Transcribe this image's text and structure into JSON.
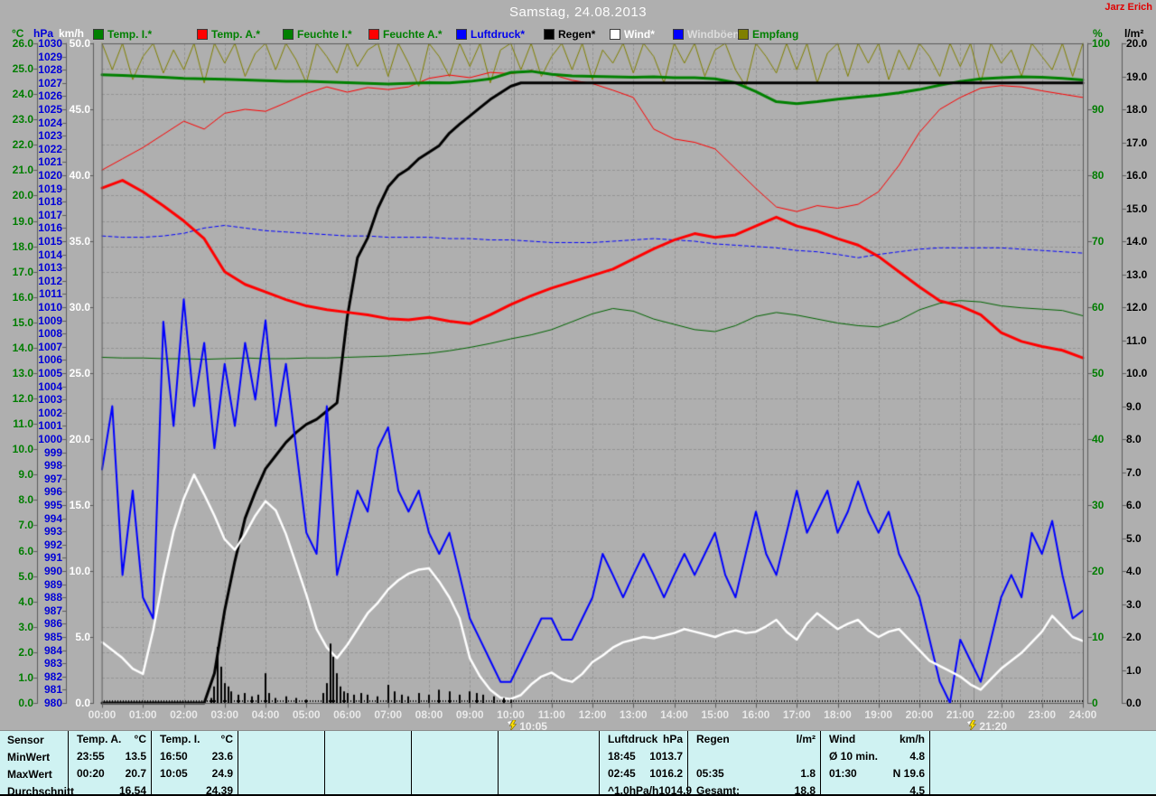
{
  "header": {
    "title": "Samstag, 24.08.2013",
    "author": "Jarz Erich"
  },
  "legend": [
    {
      "label": "Temp. I.*",
      "swatch": "#008000",
      "text_color": "#008000"
    },
    {
      "label": "Temp. A.*",
      "swatch": "#ff0000",
      "text_color": "#008000"
    },
    {
      "label": "Feuchte I.*",
      "swatch": "#008000",
      "text_color": "#008000"
    },
    {
      "label": "Feuchte A.*",
      "swatch": "#ff0000",
      "text_color": "#008000"
    },
    {
      "label": "Luftdruck*",
      "swatch": "#0000ff",
      "text_color": "#0000ee"
    },
    {
      "label": "Regen*",
      "swatch": "#000000",
      "text_color": "#000000"
    },
    {
      "label": "Wind*",
      "swatch": "#ffffff",
      "text_color": "#ffffff"
    },
    {
      "label": "Windböen",
      "swatch": "#0000ff",
      "text_color": "#dcdcdc"
    },
    {
      "label": "Empfang",
      "swatch": "#808000",
      "text_color": "#008000"
    }
  ],
  "chart_data": {
    "type": "line",
    "title": "Samstag, 24.08.2013",
    "x_start": 0,
    "x_end": 24,
    "grid": "dashed, vertical each hour, horizontal each 1°C",
    "x_tick_labels": [
      "00:00",
      "01:00",
      "02:00",
      "03:00",
      "04:00",
      "05:00",
      "06:00",
      "07:00",
      "08:00",
      "09:00",
      "10:00",
      "11:00",
      "12:00",
      "13:00",
      "14:00",
      "15:00",
      "16:00",
      "17:00",
      "18:00",
      "19:00",
      "20:00",
      "21:00",
      "22:00",
      "23:00",
      "24:00"
    ],
    "axes": {
      "temp": {
        "unit": "°C",
        "color": "#007d00",
        "min": 0,
        "max": 26,
        "step": 1,
        "decimals": 1
      },
      "hpa": {
        "unit": "hPa",
        "color": "#0000d8",
        "min": 980,
        "max": 1030,
        "step": 1,
        "decimals": 0
      },
      "kmh": {
        "unit": "km/h",
        "color": "#ffffff",
        "min": 0,
        "max": 50,
        "step": 5,
        "decimals": 1
      },
      "pct": {
        "unit": "%",
        "color": "#007d00",
        "min": 0,
        "max": 100,
        "step": 10,
        "decimals": 0
      },
      "lm2": {
        "unit": "l/m²",
        "color": "#000000",
        "min": 0,
        "max": 20,
        "step": 1,
        "decimals": 1
      }
    },
    "markers": [
      {
        "label": "10:05",
        "hour": 10.083
      },
      {
        "label": "21:20",
        "hour": 21.333
      }
    ],
    "series": [
      {
        "name": "Empfang",
        "axis": "pct",
        "color": "#808000",
        "width": 1,
        "step_min": 15,
        "values": [
          100,
          96,
          100,
          94.5,
          98,
          100,
          95.5,
          99,
          96,
          100,
          94,
          100,
          97,
          100,
          95,
          98.5,
          100,
          96,
          100,
          97.5,
          94,
          100,
          98,
          95.5,
          100,
          96.5,
          99,
          100,
          95,
          100,
          97,
          93.5,
          100,
          98,
          95,
          100,
          96.5,
          100,
          94,
          99,
          100,
          96,
          100,
          95,
          98,
          100,
          96,
          100,
          94.5,
          99,
          97,
          100,
          95.5,
          100,
          98,
          94,
          100,
          97,
          100,
          95,
          99,
          100,
          96,
          93.5,
          100,
          98,
          95.5,
          100,
          96,
          100,
          94,
          98.5,
          100,
          95,
          100,
          97,
          100,
          94.5,
          99,
          96,
          100,
          98,
          95,
          100,
          96.5,
          100,
          94,
          100,
          97,
          99,
          95,
          100,
          98,
          96,
          100,
          95,
          100
        ]
      },
      {
        "name": "Luftdruck",
        "axis": "hpa",
        "color": "#0000ff",
        "width": 1,
        "dash": [
          4,
          3
        ],
        "step_min": 30,
        "values": [
          1015.4,
          1015.3,
          1015.3,
          1015.4,
          1015.6,
          1016.0,
          1016.2,
          1016.0,
          1015.8,
          1015.7,
          1015.6,
          1015.5,
          1015.4,
          1015.4,
          1015.3,
          1015.3,
          1015.3,
          1015.2,
          1015.2,
          1015.1,
          1015.1,
          1015.0,
          1014.9,
          1014.9,
          1014.9,
          1015.0,
          1015.1,
          1015.2,
          1015.1,
          1015.0,
          1014.8,
          1014.7,
          1014.6,
          1014.5,
          1014.3,
          1014.2,
          1014.0,
          1013.75,
          1014.0,
          1014.2,
          1014.4,
          1014.5,
          1014.5,
          1014.5,
          1014.5,
          1014.4,
          1014.3,
          1014.2,
          1014.1
        ]
      },
      {
        "name": "Feuchte I.",
        "axis": "pct",
        "color": "#006400",
        "width": 1,
        "step_min": 30,
        "values": [
          52.4,
          52.3,
          52.3,
          52.2,
          52.2,
          52.1,
          52.2,
          52.3,
          52.2,
          52.2,
          52.3,
          52.3,
          52.4,
          52.5,
          52.6,
          52.8,
          53.0,
          53.4,
          53.9,
          54.5,
          55.2,
          55.8,
          56.6,
          57.8,
          59.0,
          59.8,
          59.4,
          58.2,
          57.4,
          56.6,
          56.3,
          57.2,
          58.6,
          59.2,
          58.8,
          58.2,
          57.6,
          57.2,
          57.0,
          58.0,
          59.6,
          60.6,
          61.0,
          60.8,
          60.2,
          59.9,
          59.7,
          59.5,
          58.7
        ]
      },
      {
        "name": "Feuchte A.",
        "axis": "pct",
        "color": "#ff0000",
        "width": 1,
        "step_min": 30,
        "values": [
          80.8,
          82.5,
          84.2,
          86.2,
          88.2,
          87.0,
          89.4,
          90.0,
          89.7,
          91.0,
          92.4,
          93.4,
          92.6,
          93.3,
          93.0,
          93.4,
          94.7,
          95.2,
          94.8,
          95.6,
          95.4,
          95.9,
          95.3,
          94.4,
          93.9,
          92.9,
          91.8,
          87.0,
          85.5,
          85.0,
          84.0,
          81.0,
          78.0,
          75.2,
          74.5,
          75.4,
          75.0,
          75.6,
          77.5,
          81.5,
          86.5,
          90.0,
          91.8,
          93.2,
          93.6,
          93.4,
          92.8,
          92.3,
          91.8
        ]
      },
      {
        "name": "Temp. I.",
        "axis": "temp",
        "color": "#008000",
        "width": 3,
        "step_min": 30,
        "values": [
          24.76,
          24.74,
          24.7,
          24.66,
          24.62,
          24.6,
          24.58,
          24.56,
          24.53,
          24.5,
          24.5,
          24.48,
          24.45,
          24.42,
          24.4,
          24.42,
          24.45,
          24.44,
          24.5,
          24.6,
          24.85,
          24.9,
          24.78,
          24.72,
          24.7,
          24.68,
          24.66,
          24.68,
          24.65,
          24.65,
          24.6,
          24.45,
          24.1,
          23.7,
          23.62,
          23.7,
          23.8,
          23.88,
          23.95,
          24.05,
          24.18,
          24.35,
          24.5,
          24.6,
          24.65,
          24.68,
          24.66,
          24.62,
          24.56
        ]
      },
      {
        "name": "Regen (Summe)",
        "axis": "lm2",
        "color": "#000000",
        "width": 3,
        "step_min": 15,
        "values": [
          0,
          0,
          0,
          0,
          0,
          0,
          0,
          0,
          0,
          0,
          0,
          0.9,
          2.8,
          4.3,
          5.6,
          6.4,
          7.1,
          7.5,
          7.9,
          8.2,
          8.45,
          8.6,
          8.85,
          9.1,
          11.7,
          13.5,
          14.1,
          15.0,
          15.65,
          16.0,
          16.2,
          16.5,
          16.7,
          16.9,
          17.28,
          17.55,
          17.8,
          18.05,
          18.3,
          18.5,
          18.7,
          18.8,
          18.8,
          18.8,
          18.8,
          18.8,
          18.8,
          18.8,
          18.8,
          18.8,
          18.8,
          18.8,
          18.8,
          18.8,
          18.8,
          18.8,
          18.8,
          18.8,
          18.8,
          18.8,
          18.8,
          18.8,
          18.8,
          18.8,
          18.8,
          18.8,
          18.8,
          18.8,
          18.8,
          18.8,
          18.8,
          18.8,
          18.8,
          18.8,
          18.8,
          18.8,
          18.8,
          18.8,
          18.8,
          18.8,
          18.8,
          18.8,
          18.8,
          18.8,
          18.8,
          18.8,
          18.8,
          18.8,
          18.8,
          18.8,
          18.8,
          18.8,
          18.8,
          18.8,
          18.8,
          18.8,
          18.8
        ]
      },
      {
        "name": "Temp. A.",
        "axis": "temp",
        "color": "#ff0000",
        "width": 3,
        "step_min": 30,
        "values": [
          20.3,
          20.6,
          20.15,
          19.6,
          19.0,
          18.3,
          17.0,
          16.5,
          16.2,
          15.9,
          15.65,
          15.5,
          15.4,
          15.3,
          15.15,
          15.1,
          15.2,
          15.05,
          14.95,
          15.3,
          15.7,
          16.05,
          16.35,
          16.6,
          16.85,
          17.1,
          17.5,
          17.9,
          18.25,
          18.5,
          18.35,
          18.45,
          18.8,
          19.15,
          18.8,
          18.6,
          18.3,
          18.05,
          17.6,
          17.0,
          16.4,
          15.85,
          15.65,
          15.3,
          14.6,
          14.25,
          14.05,
          13.9,
          13.6
        ]
      },
      {
        "name": "Windböen",
        "axis": "kmh",
        "color": "#0000ff",
        "width": 2,
        "step_min": 15,
        "values": [
          17.7,
          22.5,
          9.7,
          16.1,
          8.0,
          6.4,
          28.9,
          21.0,
          30.6,
          22.5,
          27.3,
          19.3,
          25.7,
          21.0,
          27.3,
          23.0,
          29.0,
          21.0,
          25.7,
          19.3,
          12.9,
          11.3,
          22.5,
          9.7,
          12.9,
          16.1,
          14.5,
          19.3,
          20.9,
          16.1,
          14.5,
          16.1,
          12.9,
          11.3,
          12.9,
          9.7,
          6.4,
          4.8,
          3.2,
          1.6,
          1.6,
          3.2,
          4.8,
          6.4,
          6.4,
          4.8,
          4.8,
          6.4,
          8.0,
          11.3,
          9.7,
          8.0,
          9.7,
          11.3,
          9.7,
          8.0,
          9.7,
          11.3,
          9.7,
          11.3,
          12.9,
          9.7,
          8.0,
          11.3,
          14.5,
          11.3,
          9.7,
          12.9,
          16.1,
          12.9,
          14.5,
          16.1,
          12.9,
          14.5,
          16.8,
          14.5,
          12.9,
          14.5,
          11.3,
          9.7,
          8.0,
          4.8,
          1.6,
          0.0,
          4.8,
          3.2,
          1.6,
          4.8,
          8.0,
          9.7,
          8.0,
          12.9,
          11.3,
          13.8,
          9.7,
          6.4,
          7.0
        ]
      },
      {
        "name": "Wind",
        "axis": "kmh",
        "color": "#ffffff",
        "width": 2.5,
        "step_min": 15,
        "values": [
          4.6,
          4.0,
          3.4,
          2.6,
          2.2,
          5.5,
          9.5,
          13.0,
          15.5,
          17.3,
          15.8,
          14.2,
          12.4,
          11.6,
          12.8,
          14.2,
          15.3,
          14.6,
          12.8,
          10.5,
          8.2,
          5.6,
          4.2,
          3.4,
          4.4,
          5.6,
          6.8,
          7.6,
          8.6,
          9.3,
          9.8,
          10.1,
          10.2,
          9.2,
          8.0,
          6.4,
          3.4,
          2.0,
          1.0,
          0.4,
          0.3,
          0.6,
          1.4,
          2.0,
          2.3,
          1.8,
          1.6,
          2.2,
          3.1,
          3.6,
          4.2,
          4.6,
          4.8,
          5.0,
          4.9,
          5.1,
          5.3,
          5.6,
          5.4,
          5.2,
          5.0,
          5.3,
          5.5,
          5.3,
          5.4,
          5.8,
          6.3,
          5.4,
          4.8,
          6.0,
          6.8,
          6.2,
          5.6,
          6.0,
          6.3,
          5.5,
          5.0,
          5.4,
          5.6,
          4.8,
          4.0,
          3.2,
          2.8,
          2.4,
          2.0,
          1.4,
          1.0,
          1.8,
          2.6,
          3.2,
          3.8,
          4.6,
          5.4,
          6.6,
          5.8,
          5.0,
          4.7
        ]
      }
    ],
    "rain_bars": [
      [
        2.667,
        0.15
      ],
      [
        2.75,
        0.5
      ],
      [
        2.833,
        1.7
      ],
      [
        2.917,
        1.1
      ],
      [
        3.0,
        0.6
      ],
      [
        3.083,
        0.5
      ],
      [
        3.167,
        0.35
      ],
      [
        3.333,
        0.25
      ],
      [
        3.5,
        0.3
      ],
      [
        3.667,
        0.2
      ],
      [
        3.833,
        0.25
      ],
      [
        4.0,
        0.9
      ],
      [
        4.083,
        0.3
      ],
      [
        4.25,
        0.15
      ],
      [
        4.5,
        0.2
      ],
      [
        4.75,
        0.15
      ],
      [
        5.0,
        0.1
      ],
      [
        5.417,
        0.3
      ],
      [
        5.5,
        0.6
      ],
      [
        5.583,
        1.8
      ],
      [
        5.667,
        1.4
      ],
      [
        5.75,
        0.9
      ],
      [
        5.833,
        0.5
      ],
      [
        5.917,
        0.35
      ],
      [
        6.0,
        0.3
      ],
      [
        6.167,
        0.25
      ],
      [
        6.333,
        0.3
      ],
      [
        6.5,
        0.25
      ],
      [
        6.75,
        0.2
      ],
      [
        7.0,
        0.55
      ],
      [
        7.167,
        0.35
      ],
      [
        7.333,
        0.25
      ],
      [
        7.5,
        0.2
      ],
      [
        7.75,
        0.3
      ],
      [
        8.0,
        0.25
      ],
      [
        8.25,
        0.4
      ],
      [
        8.5,
        0.35
      ],
      [
        8.75,
        0.25
      ],
      [
        9.0,
        0.35
      ],
      [
        9.167,
        0.3
      ],
      [
        9.333,
        0.25
      ],
      [
        9.583,
        0.2
      ],
      [
        9.833,
        0.15
      ],
      [
        10.0,
        0.1
      ]
    ]
  },
  "table": {
    "row_labels": [
      "Sensor",
      "MinWert",
      "MaxWert",
      "Durchschnitt"
    ],
    "columns": [
      {
        "name": "Temp. A.",
        "unit": "°C",
        "min_time": "23:55",
        "min_value": "13.5",
        "max_time": "00:20",
        "max_value": "20.7",
        "avg_label": "",
        "avg_value": "16.54"
      },
      {
        "name": "Temp. I.",
        "unit": "°C",
        "min_time": "16:50",
        "min_value": "23.6",
        "max_time": "10:05",
        "max_value": "24.9",
        "avg_label": "",
        "avg_value": "24.39"
      },
      {
        "name": "Luftdruck",
        "unit": "hPa",
        "min_time": "18:45",
        "min_value": "1013.7",
        "max_time": "02:45",
        "max_value": "1016.2",
        "avg_label": "^1.0hPa/h",
        "avg_value": "1014.9"
      },
      {
        "name": "Regen",
        "unit": "l/m²",
        "min_time": "",
        "min_value": "",
        "max_time": "05:35",
        "max_value": "1.8",
        "avg_label": "Gesamt:",
        "avg_value": "18.8"
      },
      {
        "name": "Wind",
        "unit": "km/h",
        "min_time": "Ø 10 min.",
        "min_value": "4.8",
        "max_time": "01:30",
        "max_value": "N 19.6",
        "avg_label": "",
        "avg_value": "4.5"
      }
    ]
  }
}
